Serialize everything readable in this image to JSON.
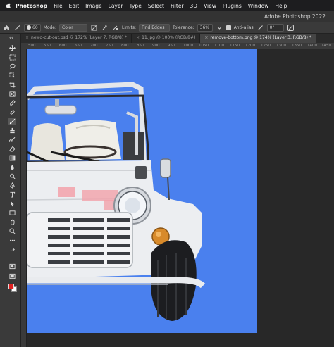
{
  "menubar": {
    "app": "Photoshop",
    "items": [
      "File",
      "Edit",
      "Image",
      "Layer",
      "Type",
      "Select",
      "Filter",
      "3D",
      "View",
      "Plugins",
      "Window",
      "Help"
    ]
  },
  "window": {
    "title": "Adobe Photoshop 2022"
  },
  "options": {
    "brush_size": "60",
    "mode_label": "Mode:",
    "mode_value": "Color",
    "limits_label": "Limits:",
    "limits_value": "Find Edges",
    "tolerance_label": "Tolerance:",
    "tolerance_value": "36%",
    "antialias_label": "Anti-alias",
    "angle_value": "0°"
  },
  "tabs": [
    "newo-cut-out.psd @ 172% (Layer 7, RGB/8) *",
    "11.jpg @ 100% (RGB/8#)",
    "remove-bottom.png @ 174% (Layer 3, RGB/8) *"
  ],
  "ruler": {
    "ticks": [
      "500",
      "550",
      "600",
      "650",
      "700",
      "750",
      "800",
      "850",
      "900",
      "950",
      "1000",
      "1050",
      "1100",
      "1150",
      "1200",
      "1250",
      "1300",
      "1350",
      "1400",
      "1450"
    ]
  },
  "colors": {
    "foreground": "#e02020",
    "background": "#ffffff",
    "canvas_bg": "#4a80ee"
  }
}
